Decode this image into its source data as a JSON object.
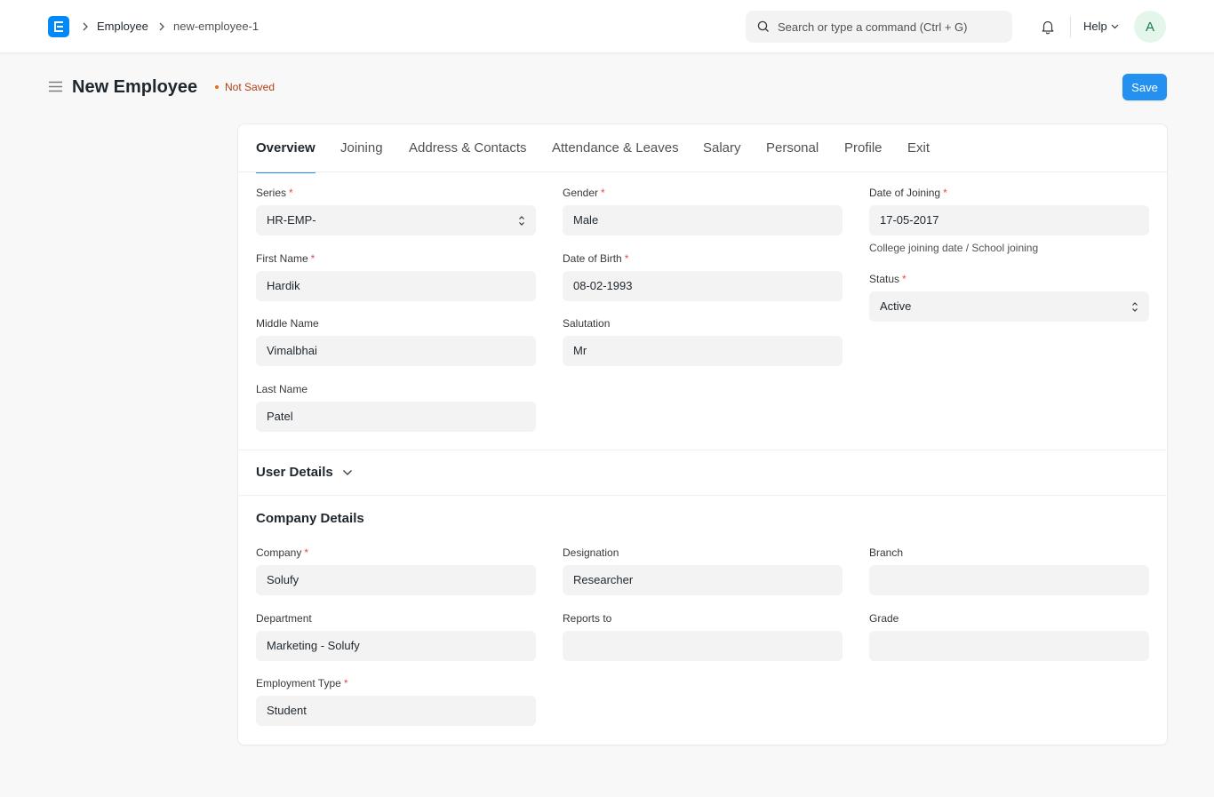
{
  "nav": {
    "breadcrumbs": [
      "Employee",
      "new-employee-1"
    ],
    "search_placeholder": "Search or type a command (Ctrl + G)",
    "help_label": "Help",
    "avatar_initial": "A"
  },
  "page": {
    "title": "New Employee",
    "status": "Not Saved",
    "save_label": "Save"
  },
  "tabs": [
    "Overview",
    "Joining",
    "Address & Contacts",
    "Attendance & Leaves",
    "Salary",
    "Personal",
    "Profile",
    "Exit"
  ],
  "overview": {
    "series": {
      "label": "Series",
      "value": "HR-EMP-"
    },
    "first_name": {
      "label": "First Name",
      "value": "Hardik"
    },
    "middle_name": {
      "label": "Middle Name",
      "value": "Vimalbhai"
    },
    "last_name": {
      "label": "Last Name",
      "value": "Patel"
    },
    "gender": {
      "label": "Gender",
      "value": "Male"
    },
    "date_of_birth": {
      "label": "Date of Birth",
      "value": "08-02-1993"
    },
    "salutation": {
      "label": "Salutation",
      "value": "Mr"
    },
    "date_of_joining": {
      "label": "Date of Joining",
      "value": "17-05-2017",
      "description": "College joining date / School joining"
    },
    "status": {
      "label": "Status",
      "value": "Active"
    }
  },
  "user_details": {
    "title": "User Details"
  },
  "company_details": {
    "title": "Company Details",
    "company": {
      "label": "Company",
      "value": "Solufy"
    },
    "department": {
      "label": "Department",
      "value": "Marketing - Solufy"
    },
    "employment_type": {
      "label": "Employment Type",
      "value": "Student"
    },
    "designation": {
      "label": "Designation",
      "value": "Researcher"
    },
    "reports_to": {
      "label": "Reports to",
      "value": ""
    },
    "branch": {
      "label": "Branch",
      "value": ""
    },
    "grade": {
      "label": "Grade",
      "value": ""
    }
  },
  "required_marker": "*",
  "colors": {
    "primary": "#2490ef",
    "not_saved": "#b4401a",
    "required": "#e24c4c",
    "field_bg": "#f3f3f3"
  }
}
